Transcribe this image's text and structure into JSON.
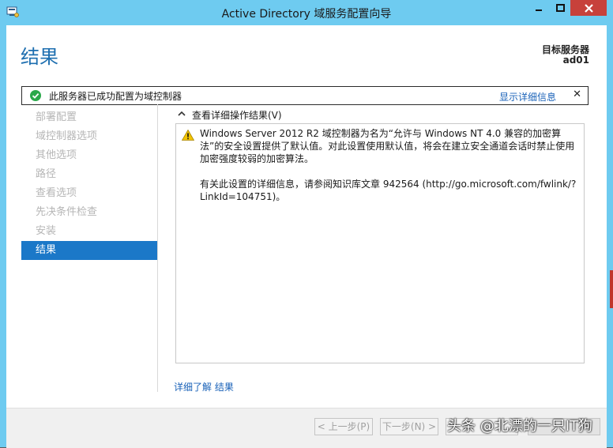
{
  "window": {
    "title": "Active Directory 域服务配置向导",
    "controls": {
      "minimize": "–",
      "maximize": "□",
      "close": "✕"
    }
  },
  "page": {
    "title": "结果",
    "target_server_label": "目标服务器",
    "target_server_value": "ad01"
  },
  "status": {
    "message": "此服务器已成功配置为域控制器",
    "details_link": "显示详细信息",
    "close": "✕",
    "color": "#2aa84a"
  },
  "nav": {
    "items": [
      {
        "label": "部署配置",
        "active": false
      },
      {
        "label": "域控制器选项",
        "active": false
      },
      {
        "label": "其他选项",
        "active": false
      },
      {
        "label": "路径",
        "active": false
      },
      {
        "label": "查看选项",
        "active": false
      },
      {
        "label": "先决条件检查",
        "active": false
      },
      {
        "label": "安装",
        "active": false
      },
      {
        "label": "结果",
        "active": true
      }
    ]
  },
  "details": {
    "toggle_label": "查看详细操作结果(V)",
    "warning_icon": "warning-icon",
    "paragraph1": "Windows Server 2012 R2 域控制器为名为“允许与 Windows NT 4.0 兼容的加密算法”的安全设置提供了默认值。对此设置使用默认值，将会在建立安全通道会话时禁止使用加密强度较弱的加密算法。",
    "paragraph2": "有关此设置的详细信息，请参阅知识库文章 942564 (http://go.microsoft.com/fwlink/?LinkId=104751)。"
  },
  "learn_more": "详细了解 结果",
  "footer": {
    "prev": "< 上一步(P)",
    "next": "下一步(N) >",
    "install": "",
    "cancel": "",
    "watermark": "头条 @北漂的一只IT狗"
  },
  "colors": {
    "accent": "#1b78c8",
    "titlebar": "#6ecbf0",
    "close_red": "#c7413b"
  }
}
